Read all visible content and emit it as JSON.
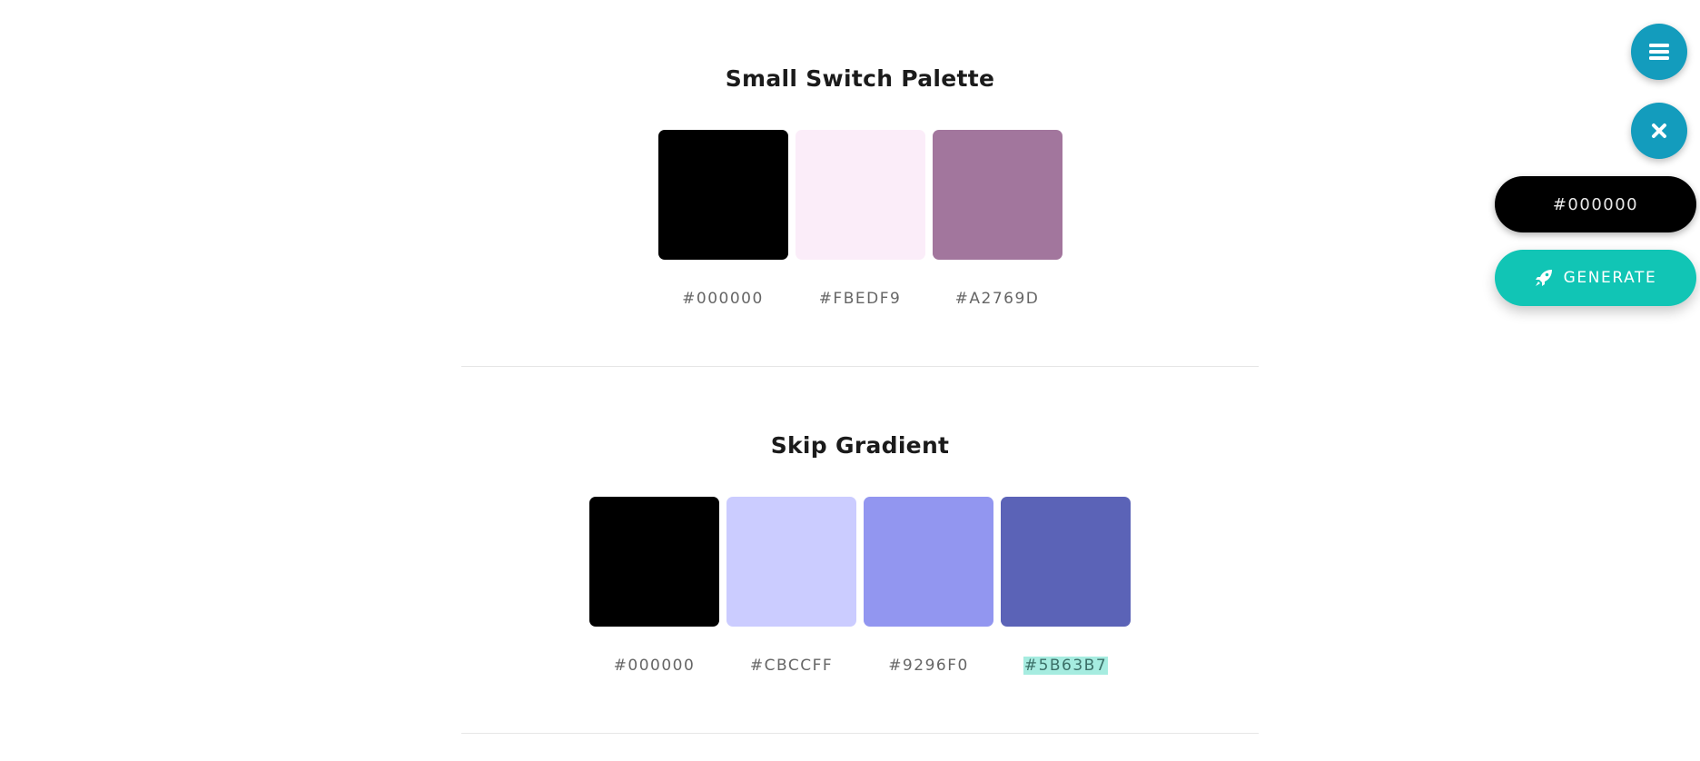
{
  "palettes": [
    {
      "title": "Small Switch Palette",
      "swatches": [
        {
          "hex": "#000000",
          "color": "#000000"
        },
        {
          "hex": "#FBEDF9",
          "color": "#FBEDF9"
        },
        {
          "hex": "#A2769D",
          "color": "#A2769D"
        }
      ]
    },
    {
      "title": "Skip Gradient",
      "swatches": [
        {
          "hex": "#000000",
          "color": "#000000"
        },
        {
          "hex": "#CBCCFF",
          "color": "#CBCCFF"
        },
        {
          "hex": "#9296F0",
          "color": "#9296F0"
        },
        {
          "hex": "#5B63B7",
          "color": "#5B63B7"
        }
      ]
    }
  ],
  "controls": {
    "menu_icon": "menu-icon",
    "close_icon": "close-icon",
    "color_input_value": "#000000",
    "generate_label": "GENERATE",
    "generate_icon": "rocket-icon"
  },
  "colors": {
    "fab": "#139cbd",
    "generate": "#11c5b5",
    "highlight": "#a6ece0"
  }
}
